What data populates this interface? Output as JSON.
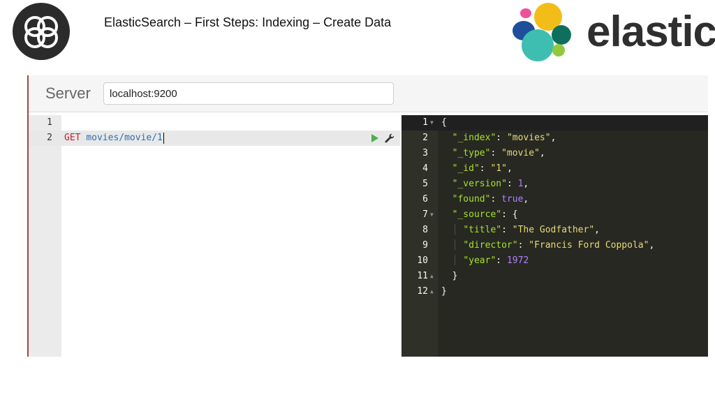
{
  "slide": {
    "title": "ElasticSearch – First Steps: Indexing – Create Data",
    "brand_word": "elastic"
  },
  "server": {
    "label": "Server",
    "value": "localhost:9200"
  },
  "request_editor": {
    "lines": [
      {
        "number": "1",
        "method": "",
        "path": ""
      },
      {
        "number": "2",
        "method": "GET",
        "path": "movies/movie/1"
      }
    ],
    "icons": [
      "play-icon",
      "wrench-icon"
    ]
  },
  "response_editor": {
    "lines": [
      {
        "number": "1",
        "text": "{"
      },
      {
        "number": "2",
        "key": "\"_index\"",
        "value": "\"movies\"",
        "tail": ","
      },
      {
        "number": "3",
        "key": "\"_type\"",
        "value": "\"movie\"",
        "tail": ","
      },
      {
        "number": "4",
        "key": "\"_id\"",
        "value": "\"1\"",
        "tail": ","
      },
      {
        "number": "5",
        "key": "\"_version\"",
        "value": "1",
        "tail": ","
      },
      {
        "number": "6",
        "key": "\"found\"",
        "value": "true",
        "tail": ","
      },
      {
        "number": "7",
        "key": "\"_source\"",
        "value": "{",
        "tail": ""
      },
      {
        "number": "8",
        "key": "\"title\"",
        "value": "\"The Godfather\"",
        "tail": ","
      },
      {
        "number": "9",
        "key": "\"director\"",
        "value": "\"Francis Ford Coppola\"",
        "tail": ","
      },
      {
        "number": "10",
        "key": "\"year\"",
        "value": "1972",
        "tail": ""
      },
      {
        "number": "11",
        "text": "}"
      },
      {
        "number": "12",
        "text": "}"
      }
    ]
  },
  "colors": {
    "method": "#c5222b",
    "path": "#2a6fb3",
    "json_key": "#a6e22e",
    "json_string": "#e6db74",
    "json_number": "#ae81ff",
    "editor_bg": "#272822"
  }
}
